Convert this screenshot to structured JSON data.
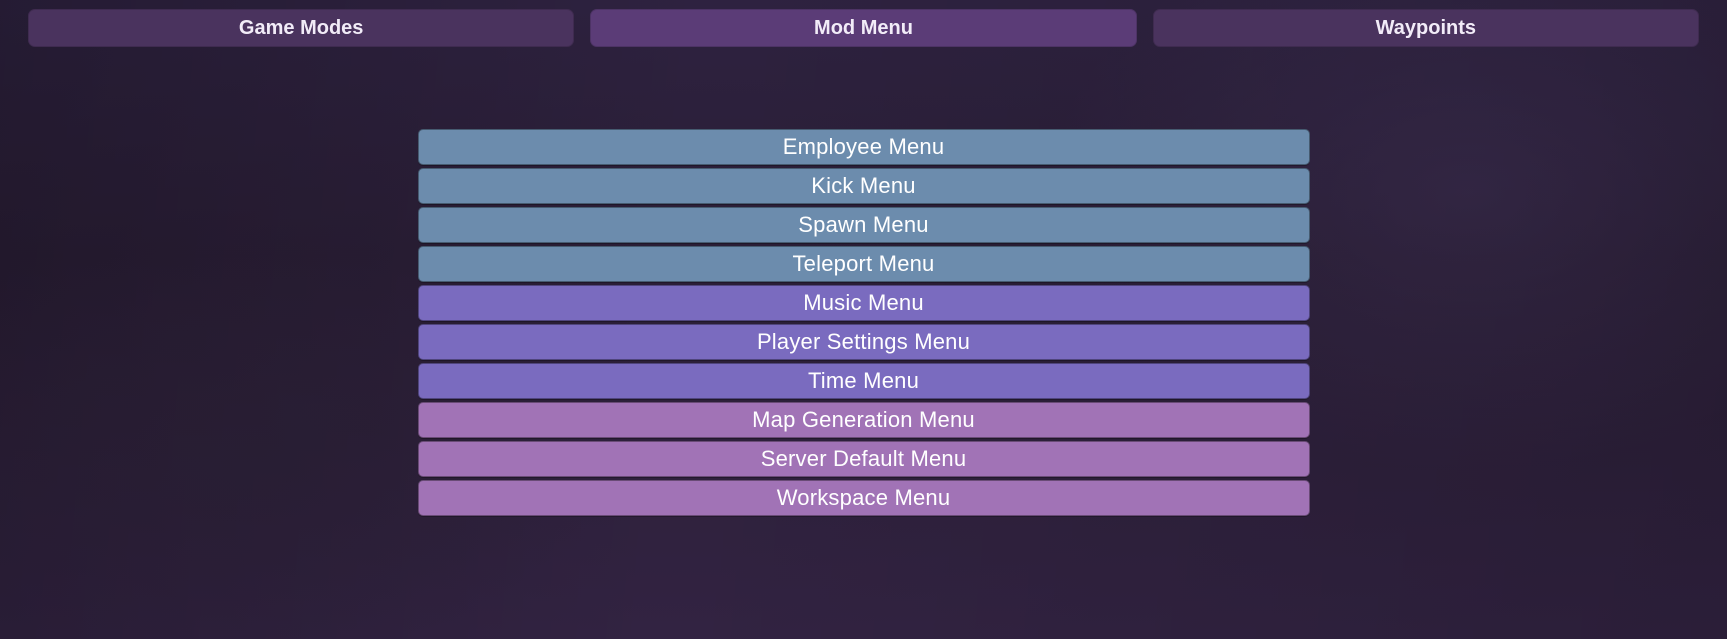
{
  "tabs": {
    "game_modes": "Game Modes",
    "mod_menu": "Mod Menu",
    "waypoints": "Waypoints",
    "active": "mod_menu"
  },
  "menu": {
    "employee": {
      "label": "Employee Menu",
      "color": "blue"
    },
    "kick": {
      "label": "Kick Menu",
      "color": "blue"
    },
    "spawn": {
      "label": "Spawn Menu",
      "color": "blue"
    },
    "teleport": {
      "label": "Teleport Menu",
      "color": "blue"
    },
    "music": {
      "label": "Music Menu",
      "color": "purple"
    },
    "player_settings": {
      "label": "Player Settings Menu",
      "color": "purple"
    },
    "time": {
      "label": "Time Menu",
      "color": "purple"
    },
    "map_generation": {
      "label": "Map Generation Menu",
      "color": "pink"
    },
    "server_default": {
      "label": "Server Default Menu",
      "color": "pink"
    },
    "workspace": {
      "label": "Workspace Menu",
      "color": "pink"
    }
  },
  "colors": {
    "blue": "#6c8cad",
    "purple": "#7a6bbf",
    "pink": "#a173b6"
  }
}
